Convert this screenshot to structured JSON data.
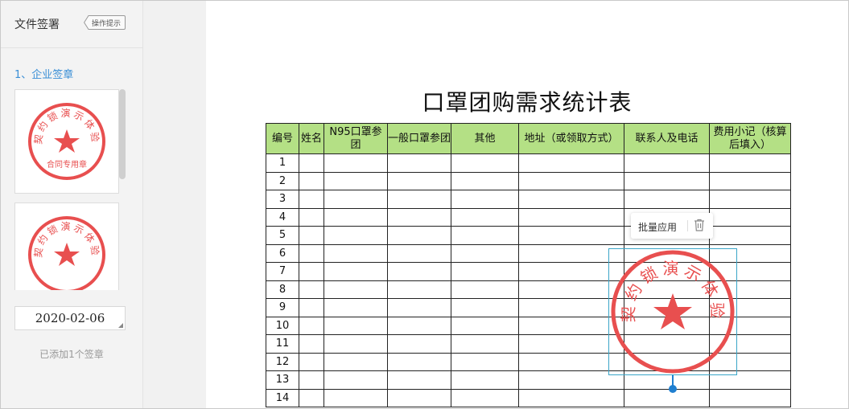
{
  "sidebar": {
    "title": "文件签署",
    "tip_button": "操作提示",
    "section_title": "1、企业签章",
    "stamps": [
      {
        "name": "contract-stamp",
        "top_text": "契约锁演示体验",
        "bottom_text": "合同专用章"
      },
      {
        "name": "company-stamp",
        "top_text": "契约锁演示体验",
        "bottom_text": ""
      }
    ],
    "date_value": "2020-02-06",
    "added_count": "已添加1个签章"
  },
  "document": {
    "title": "口罩团购需求统计表",
    "headers": [
      "编号",
      "姓名",
      "N95口罩参团",
      "一般口罩参团",
      "其他",
      "地址（或领取方式）",
      "联系人及电话",
      "费用小记（核算后填入）"
    ],
    "row_numbers": [
      "1",
      "2",
      "3",
      "4",
      "5",
      "6",
      "7",
      "8",
      "9",
      "10",
      "11",
      "12",
      "13",
      "14"
    ]
  },
  "float_toolbar": {
    "batch_apply": "批量应用",
    "delete_icon": "trash-icon"
  },
  "placed_stamp": {
    "top_text": "契约锁演示体验"
  },
  "colors": {
    "seal_red": "#e84f4f",
    "header_green": "#b4e085",
    "accent_blue": "#3a8fd6",
    "selection_border": "#3aa5c8"
  }
}
